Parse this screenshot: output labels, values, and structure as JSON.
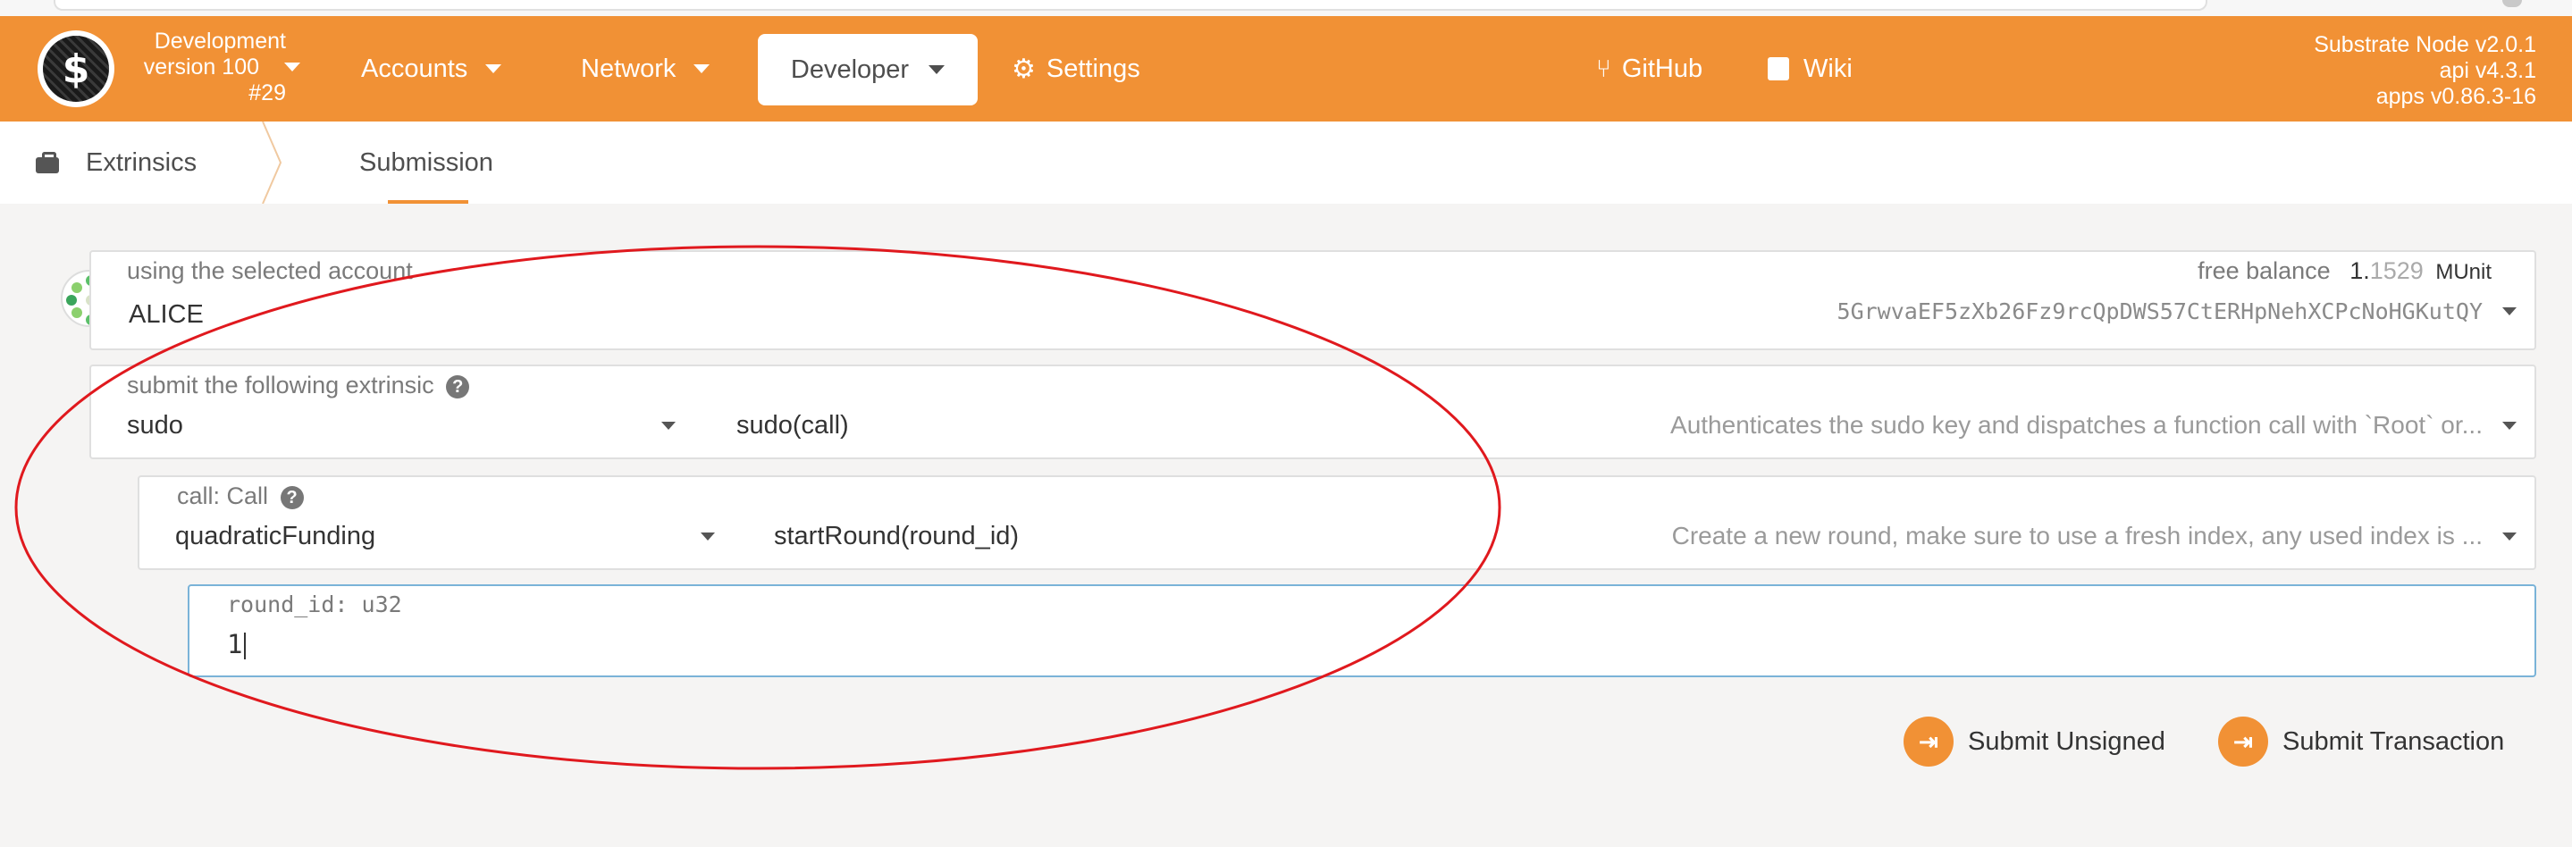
{
  "chain": {
    "name": "Development",
    "version": "version 100",
    "block": "#29"
  },
  "nav": {
    "accounts": "Accounts",
    "network": "Network",
    "developer": "Developer",
    "settings": "Settings",
    "github": "GitHub",
    "wiki": "Wiki"
  },
  "node": {
    "line1": "Substrate Node v2.0.1",
    "line2": "api v4.3.1",
    "line3": "apps v0.86.3-16"
  },
  "tabs": {
    "root": "Extrinsics",
    "active": "Submission"
  },
  "account": {
    "label": "using the selected account",
    "name": "ALICE",
    "balance_label": "free balance",
    "balance_int": "1.",
    "balance_frac": "1529",
    "balance_unit": "MUnit",
    "address": "5GrwvaEF5zXb26Fz9rcQpDWS57CtERHpNehXCPcNoHGKutQY"
  },
  "extrinsic": {
    "label": "submit the following extrinsic",
    "help": "?",
    "module": "sudo",
    "method": "sudo(call)",
    "description": "Authenticates the sudo key and dispatches a function call with `Root` or..."
  },
  "call": {
    "label": "call: Call",
    "help": "?",
    "module": "quadraticFunding",
    "method": "startRound(round_id)",
    "description": "Create a new round, make sure to use a fresh index, any used index is ..."
  },
  "param": {
    "label": "round_id: u32",
    "value": "1"
  },
  "actions": {
    "submit_unsigned": "Submit Unsigned",
    "submit_transaction": "Submit Transaction"
  },
  "colors": {
    "accent": "#f19135",
    "annotation": "#e0191e"
  }
}
